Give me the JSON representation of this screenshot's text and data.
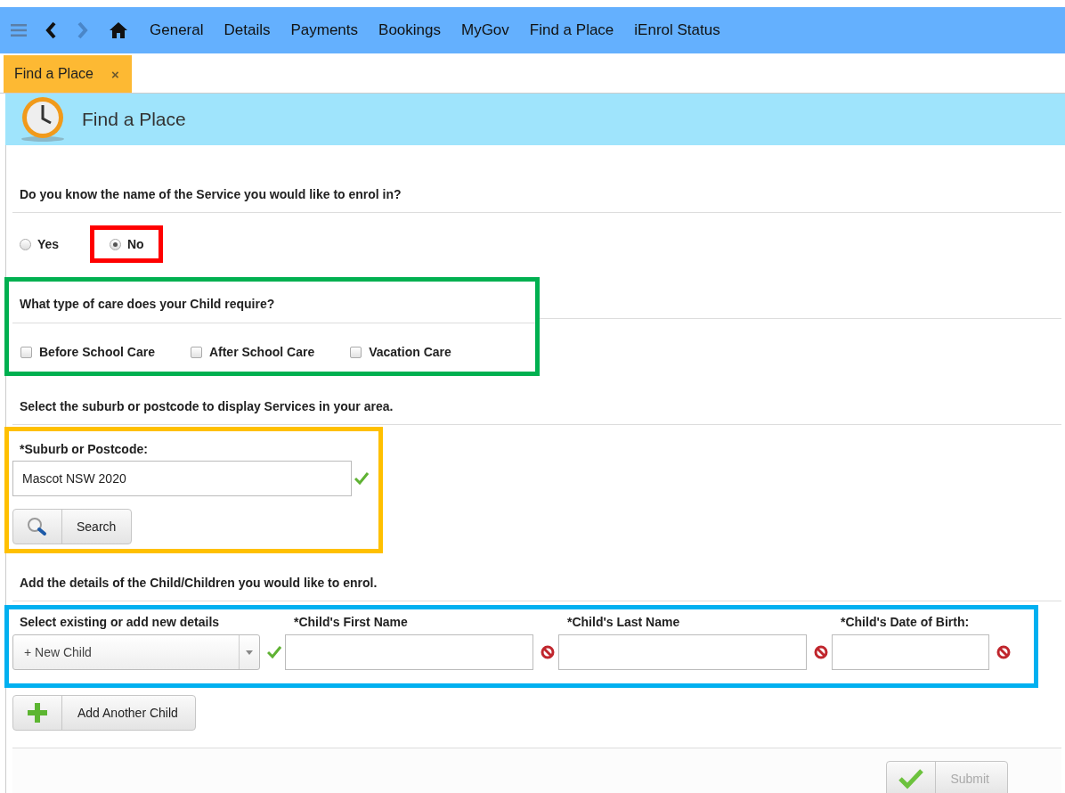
{
  "nav": {
    "items": [
      {
        "label": "General"
      },
      {
        "label": "Details"
      },
      {
        "label": "Payments"
      },
      {
        "label": "Bookings"
      },
      {
        "label": "MyGov"
      },
      {
        "label": "Find a Place"
      },
      {
        "label": "iEnrol Status"
      }
    ]
  },
  "tabs": [
    {
      "label": "Find a Place",
      "selected": true,
      "close": "×"
    }
  ],
  "header": {
    "title": "Find a Place"
  },
  "service_question": {
    "heading": "Do you know the name of the Service you would like to enrol in?",
    "options": [
      {
        "label": "Yes",
        "selected": false
      },
      {
        "label": "No",
        "selected": true,
        "color": "#ff0000"
      }
    ]
  },
  "care": {
    "heading": "What type of care does your Child require?",
    "color": "#00b050",
    "options": [
      {
        "label": "Before School Care",
        "checked": false
      },
      {
        "label": "After School Care",
        "checked": false
      },
      {
        "label": "Vacation Care",
        "checked": false
      }
    ]
  },
  "area": {
    "heading": "Select the suburb or postcode to display Services in your area.",
    "color": "#ffc000",
    "field_label": "*Suburb or Postcode:",
    "value": "Mascot NSW 2020",
    "valid": true,
    "button": "Search"
  },
  "children": {
    "heading": "Add the details of the Child/Children you would like to enrol.",
    "color": "#00b0f0",
    "columns": [
      {
        "label": "Select existing or add new details",
        "kind": "select",
        "value": "+ New Child",
        "valid": true
      },
      {
        "label": "*Child's First Name",
        "kind": "text",
        "valid": false
      },
      {
        "label": "*Child's Last Name",
        "kind": "text",
        "valid": false
      },
      {
        "label": "*Child's Date of Birth:",
        "kind": "text",
        "valid": false
      }
    ],
    "add_button": "Add Another Child"
  },
  "footer": {
    "submit": "Submit",
    "disabled": true
  }
}
